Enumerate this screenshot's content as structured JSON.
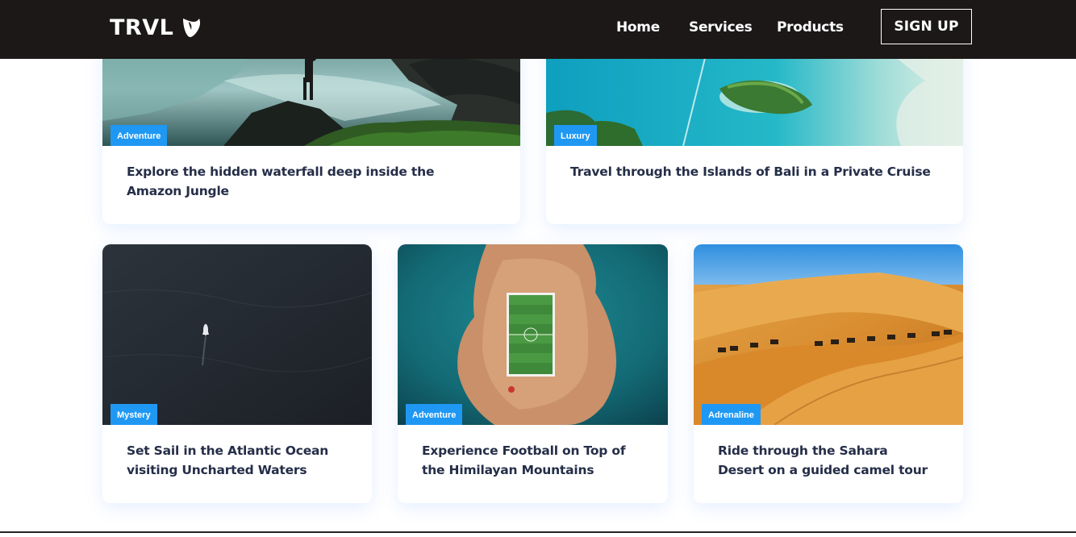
{
  "navbar": {
    "logo_text": "TRVL",
    "logo_icon": "typo3-icon",
    "links": [
      "Home",
      "Services",
      "Products"
    ],
    "signup_label": "SIGN UP"
  },
  "cards": [
    {
      "category": "Adventure",
      "title": "Explore the hidden waterfall deep inside the Amazon Jungle",
      "image": "waterfall-photo"
    },
    {
      "category": "Luxury",
      "title": "Travel through the Islands of Bali in a Private Cruise",
      "image": "islands-photo"
    },
    {
      "category": "Mystery",
      "title": "Set Sail in the Atlantic Ocean visiting Uncharted Waters",
      "image": "ocean-boat-photo"
    },
    {
      "category": "Adventure",
      "title": "Experience Football on Top of the Himilayan Mountains",
      "image": "football-island-photo"
    },
    {
      "category": "Adrenaline",
      "title": "Ride through the Sahara Desert on a guided camel tour",
      "image": "desert-camels-photo"
    }
  ],
  "colors": {
    "navbar_bg": "#1c1818",
    "badge_bg": "#1f98f4",
    "title_text": "#252e48"
  }
}
